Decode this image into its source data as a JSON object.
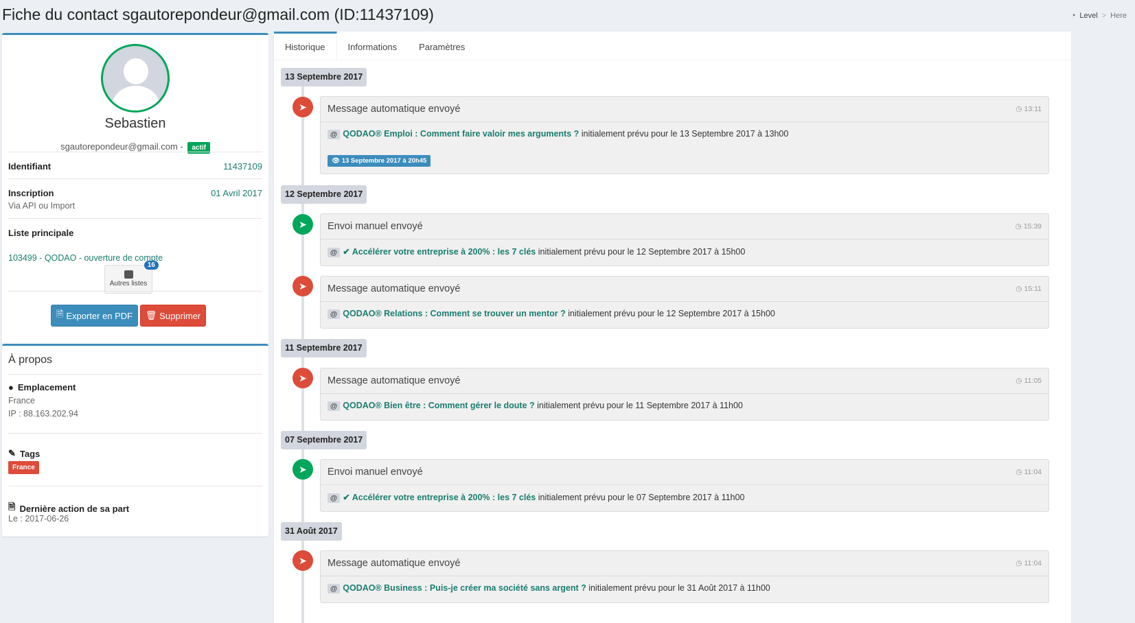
{
  "page": {
    "title": "Fiche du contact sgautorepondeur@gmail.com (ID:11437109)"
  },
  "breadcrumb": {
    "level": "Level",
    "separator": ">",
    "here": "Here"
  },
  "profile": {
    "name": "Sebastien",
    "email": "sgautorepondeur@gmail.com -",
    "status": "actif",
    "identifiant_label": "Identifiant",
    "identifiant_value": "11437109",
    "inscription_label": "Inscription",
    "inscription_value": "01 Avril 2017",
    "inscription_via": "Via API ou Import",
    "liste_label": "Liste principale",
    "liste_value": "103499 - QODAO - ouverture de compte",
    "autres_listes_label": "Autres listes",
    "autres_listes_count": "16",
    "export_label": "Exporter en PDF",
    "delete_label": "Supprimer"
  },
  "about": {
    "title": "À propos",
    "emplacement_label": "Emplacement",
    "country": "France",
    "ip": "IP : 88.163.202.94",
    "tags_label": "Tags",
    "tag": "France",
    "last_action_label": "Dernière action de sa part",
    "last_action_value": "Le : 2017-06-26"
  },
  "tabs": [
    "Historique",
    "Informations",
    "Paramètres"
  ],
  "timeline": {
    "dates": [
      "13 Septembre 2017",
      "12 Septembre 2017",
      "11 Septembre 2017",
      "07 Septembre 2017",
      "31 Août 2017"
    ],
    "items": [
      {
        "icon": "rocket-icon",
        "color": "#dd4b39",
        "title": "Message automatique envoyé",
        "time": "13:11",
        "subject": "QODAO® Emploi : Comment faire valoir mes arguments ?",
        "planned": " initialement prévu pour le 13 Septembre 2017 à 13h00",
        "viewed": "13 Septembre 2017 à 20h45"
      },
      {
        "icon": "paper-plane-icon",
        "color": "#00a65a",
        "title": "Envoi manuel envoyé",
        "time": "15:39",
        "subject": "✔ Accélérer votre entreprise à 200% : les 7 clés",
        "planned": " initialement prévu pour le 12 Septembre 2017 à 15h00"
      },
      {
        "icon": "rocket-icon",
        "color": "#dd4b39",
        "title": "Message automatique envoyé",
        "time": "15:11",
        "subject": "QODAO® Relations : Comment se trouver un mentor ?",
        "planned": " initialement prévu pour le 12 Septembre 2017 à 15h00"
      },
      {
        "icon": "rocket-icon",
        "color": "#dd4b39",
        "title": "Message automatique envoyé",
        "time": "11:05",
        "subject": "QODAO® Bien être : Comment gérer le doute ?",
        "planned": " initialement prévu pour le 11 Septembre 2017 à 11h00"
      },
      {
        "icon": "paper-plane-icon",
        "color": "#00a65a",
        "title": "Envoi manuel envoyé",
        "time": "11:04",
        "subject": "✔ Accélérer votre entreprise à 200% : les 7 clés",
        "planned": " initialement prévu pour le 07 Septembre 2017 à 11h00"
      },
      {
        "icon": "rocket-icon",
        "color": "#dd4b39",
        "title": "Message automatique envoyé",
        "time": "11:04",
        "subject": "QODAO® Business : Puis-je créer ma société sans argent ?",
        "planned": " initialement prévu pour le 31 Août 2017 à 11h00"
      }
    ]
  }
}
